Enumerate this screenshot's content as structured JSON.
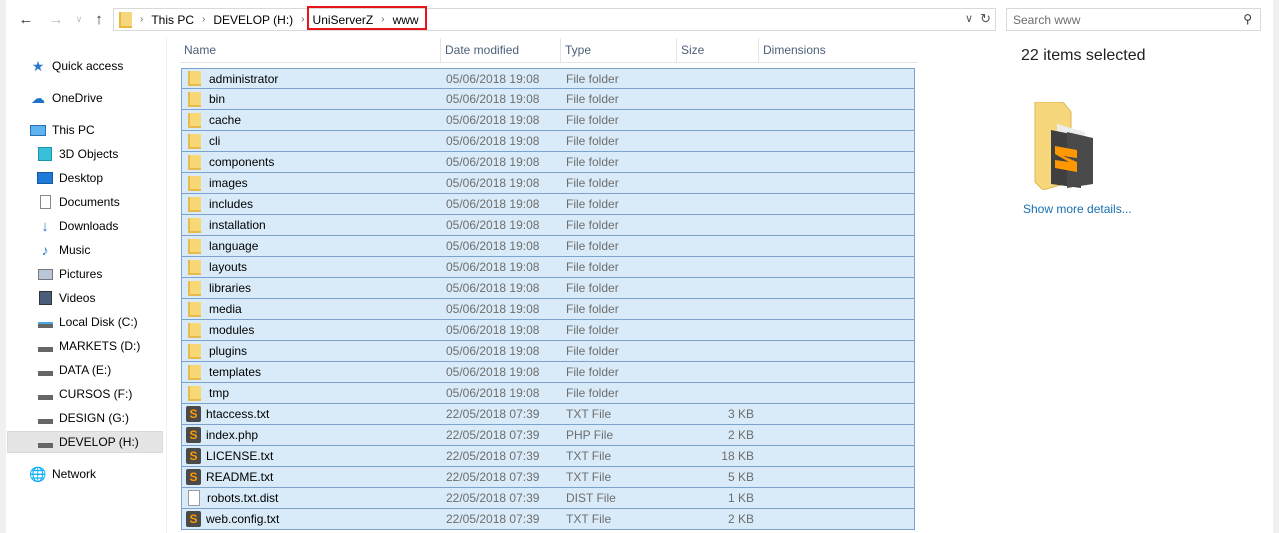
{
  "nav": {
    "back_icon": "arrow-left-icon",
    "forward_icon": "arrow-right-icon",
    "recent_icon": "chevron-down-icon",
    "up_icon": "arrow-up-icon"
  },
  "address_bar": {
    "breadcrumbs": [
      "This PC",
      "DEVELOP (H:)",
      "UniServerZ",
      "www"
    ],
    "highlighted": [
      "UniServerZ",
      "www"
    ],
    "highlight_color": "#e8141c"
  },
  "search": {
    "placeholder": "Search www",
    "value": ""
  },
  "sidebar": {
    "items": [
      {
        "label": "Quick access",
        "icon": "star-icon"
      },
      {
        "label": "OneDrive",
        "icon": "cloud-icon"
      },
      {
        "label": "This PC",
        "icon": "computer-icon"
      },
      {
        "label": "3D Objects",
        "icon": "cube-icon"
      },
      {
        "label": "Desktop",
        "icon": "desktop-icon"
      },
      {
        "label": "Documents",
        "icon": "document-icon"
      },
      {
        "label": "Downloads",
        "icon": "download-icon"
      },
      {
        "label": "Music",
        "icon": "music-icon"
      },
      {
        "label": "Pictures",
        "icon": "picture-icon"
      },
      {
        "label": "Videos",
        "icon": "video-icon"
      },
      {
        "label": "Local Disk (C:)",
        "icon": "system-drive-icon"
      },
      {
        "label": "MARKETS (D:)",
        "icon": "drive-icon"
      },
      {
        "label": "DATA (E:)",
        "icon": "drive-icon"
      },
      {
        "label": "CURSOS (F:)",
        "icon": "drive-icon"
      },
      {
        "label": "DESIGN (G:)",
        "icon": "drive-icon"
      },
      {
        "label": "DEVELOP (H:)",
        "icon": "drive-icon",
        "selected": true
      },
      {
        "label": "Network",
        "icon": "network-icon"
      }
    ]
  },
  "columns": [
    "Name",
    "Date modified",
    "Type",
    "Size",
    "Dimensions"
  ],
  "files": [
    {
      "name": "administrator",
      "date": "05/06/2018 19:08",
      "type": "File folder",
      "size": "",
      "icon": "folder"
    },
    {
      "name": "bin",
      "date": "05/06/2018 19:08",
      "type": "File folder",
      "size": "",
      "icon": "folder"
    },
    {
      "name": "cache",
      "date": "05/06/2018 19:08",
      "type": "File folder",
      "size": "",
      "icon": "folder"
    },
    {
      "name": "cli",
      "date": "05/06/2018 19:08",
      "type": "File folder",
      "size": "",
      "icon": "folder"
    },
    {
      "name": "components",
      "date": "05/06/2018 19:08",
      "type": "File folder",
      "size": "",
      "icon": "folder"
    },
    {
      "name": "images",
      "date": "05/06/2018 19:08",
      "type": "File folder",
      "size": "",
      "icon": "folder"
    },
    {
      "name": "includes",
      "date": "05/06/2018 19:08",
      "type": "File folder",
      "size": "",
      "icon": "folder"
    },
    {
      "name": "installation",
      "date": "05/06/2018 19:08",
      "type": "File folder",
      "size": "",
      "icon": "folder"
    },
    {
      "name": "language",
      "date": "05/06/2018 19:08",
      "type": "File folder",
      "size": "",
      "icon": "folder"
    },
    {
      "name": "layouts",
      "date": "05/06/2018 19:08",
      "type": "File folder",
      "size": "",
      "icon": "folder"
    },
    {
      "name": "libraries",
      "date": "05/06/2018 19:08",
      "type": "File folder",
      "size": "",
      "icon": "folder"
    },
    {
      "name": "media",
      "date": "05/06/2018 19:08",
      "type": "File folder",
      "size": "",
      "icon": "folder"
    },
    {
      "name": "modules",
      "date": "05/06/2018 19:08",
      "type": "File folder",
      "size": "",
      "icon": "folder"
    },
    {
      "name": "plugins",
      "date": "05/06/2018 19:08",
      "type": "File folder",
      "size": "",
      "icon": "folder"
    },
    {
      "name": "templates",
      "date": "05/06/2018 19:08",
      "type": "File folder",
      "size": "",
      "icon": "folder"
    },
    {
      "name": "tmp",
      "date": "05/06/2018 19:08",
      "type": "File folder",
      "size": "",
      "icon": "folder"
    },
    {
      "name": "htaccess.txt",
      "date": "22/05/2018 07:39",
      "type": "TXT File",
      "size": "3 KB",
      "icon": "sublime"
    },
    {
      "name": "index.php",
      "date": "22/05/2018 07:39",
      "type": "PHP File",
      "size": "2 KB",
      "icon": "sublime"
    },
    {
      "name": "LICENSE.txt",
      "date": "22/05/2018 07:39",
      "type": "TXT File",
      "size": "18 KB",
      "icon": "sublime"
    },
    {
      "name": "README.txt",
      "date": "22/05/2018 07:39",
      "type": "TXT File",
      "size": "5 KB",
      "icon": "sublime"
    },
    {
      "name": "robots.txt.dist",
      "date": "22/05/2018 07:39",
      "type": "DIST File",
      "size": "1 KB",
      "icon": "blank"
    },
    {
      "name": "web.config.txt",
      "date": "22/05/2018 07:39",
      "type": "TXT File",
      "size": "2 KB",
      "icon": "sublime"
    }
  ],
  "details": {
    "title": "22 items selected",
    "link": "Show more details..."
  }
}
